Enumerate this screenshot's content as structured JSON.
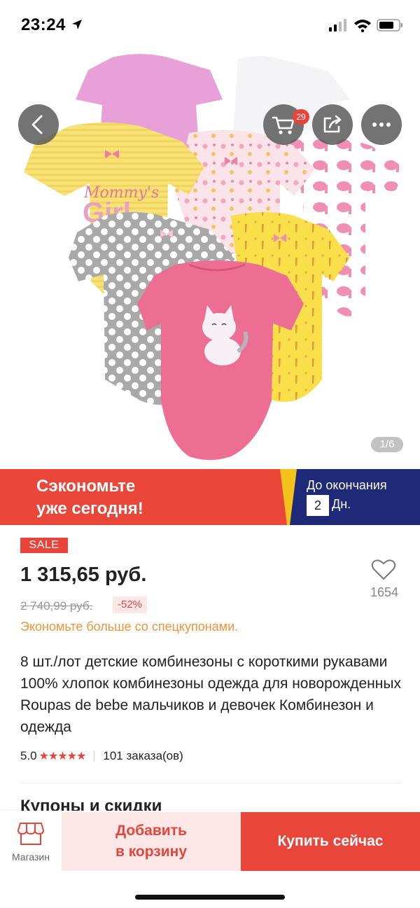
{
  "status_bar": {
    "time": "23:24"
  },
  "hero": {
    "cart_count": "29",
    "page_indicator": "1/6",
    "image_print_text": "Girl",
    "image_print_script": "Mommy's"
  },
  "promo": {
    "left_text": [
      "Сэкономьте",
      "уже сегодня!"
    ],
    "until_label": "До окончания",
    "days_value": "2",
    "days_unit": "Дн."
  },
  "product": {
    "sale_badge": "SALE",
    "price": "1 315,65 руб.",
    "wish_count": "1654",
    "old_price": "2 740,99 руб.",
    "discount": "-52%",
    "coupon_note": "Экономьте больше со спецкупонами.",
    "title": "8 шт./лот детские комбинезоны с короткими рукавами 100% хлопок комбинезоны одежда для новорожденных Roupas de bebe мальчиков и девочек Комбинезон и одежда",
    "rating": "5.0",
    "stars": "★★★★★",
    "orders": "101 заказа(ов)"
  },
  "coupons_section": {
    "title": "Купоны и скидки"
  },
  "bottom_bar": {
    "store_label": "Магазин",
    "add_to_cart": [
      "Добавить",
      "в корзину"
    ],
    "buy_now": "Купить сейчас"
  },
  "colors": {
    "accent": "#e8443a",
    "coupon_orange": "#f29339",
    "promo_navy": "#1e2a78",
    "promo_yellow": "#f5c21b"
  },
  "icons": [
    "location-arrow-icon",
    "signal-icon",
    "wifi-icon",
    "battery-icon",
    "back-arrow-icon",
    "cart-icon",
    "share-icon",
    "more-icon",
    "heart-icon",
    "store-icon"
  ]
}
